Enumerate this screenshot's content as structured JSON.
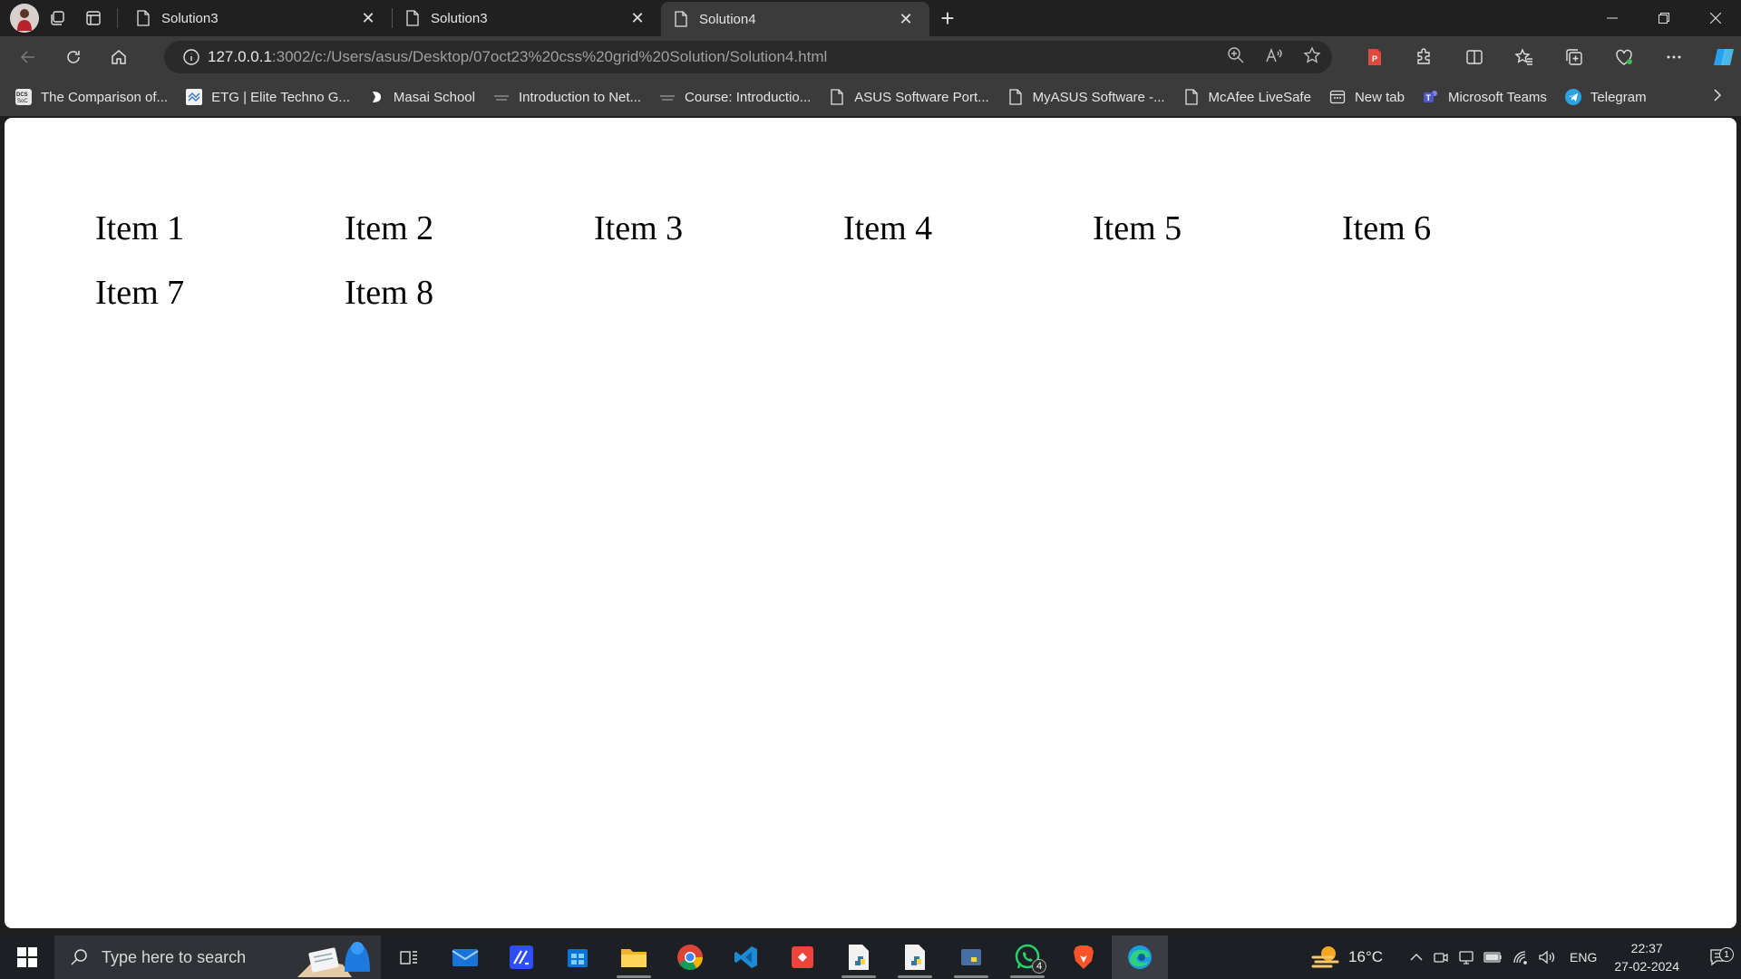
{
  "browser": {
    "tabs": [
      {
        "title": "Solution3",
        "active": false
      },
      {
        "title": "Solution3",
        "active": false
      },
      {
        "title": "Solution4",
        "active": true
      }
    ],
    "url_host": "127.0.0.1",
    "url_rest": ":3002/c:/Users/asus/Desktop/07oct23%20css%20grid%20Solution/Solution4.html"
  },
  "bookmarks": [
    {
      "label": "The Comparison of...",
      "icon": "dcs-icon"
    },
    {
      "label": "ETG | Elite Techno G...",
      "icon": "etg-icon"
    },
    {
      "label": "Masai School",
      "icon": "masai-icon"
    },
    {
      "label": "Introduction to Net...",
      "icon": "course-icon"
    },
    {
      "label": "Course: Introductio...",
      "icon": "course-icon"
    },
    {
      "label": "ASUS Software Port...",
      "icon": "page-icon"
    },
    {
      "label": "MyASUS Software -...",
      "icon": "page-icon"
    },
    {
      "label": "McAfee LiveSafe",
      "icon": "page-icon"
    },
    {
      "label": "New tab",
      "icon": "newtab-icon"
    },
    {
      "label": "Microsoft Teams",
      "icon": "teams-icon"
    },
    {
      "label": "Telegram",
      "icon": "telegram-icon"
    }
  ],
  "page": {
    "items": [
      "Item 1",
      "Item 2",
      "Item 3",
      "Item 4",
      "Item 5",
      "Item 6",
      "Item 7",
      "Item 8"
    ]
  },
  "taskbar": {
    "search_placeholder": "Type here to search",
    "temperature": "16°C",
    "language": "ENG",
    "time": "22:37",
    "date": "27-02-2024",
    "whatsapp_badge": "4",
    "notification_count": "1"
  },
  "colors": {
    "chrome_dark": "#202020",
    "toolbar": "#3b3b3b",
    "page_bg": "#ffffff",
    "taskbar": "#1c1f24"
  }
}
